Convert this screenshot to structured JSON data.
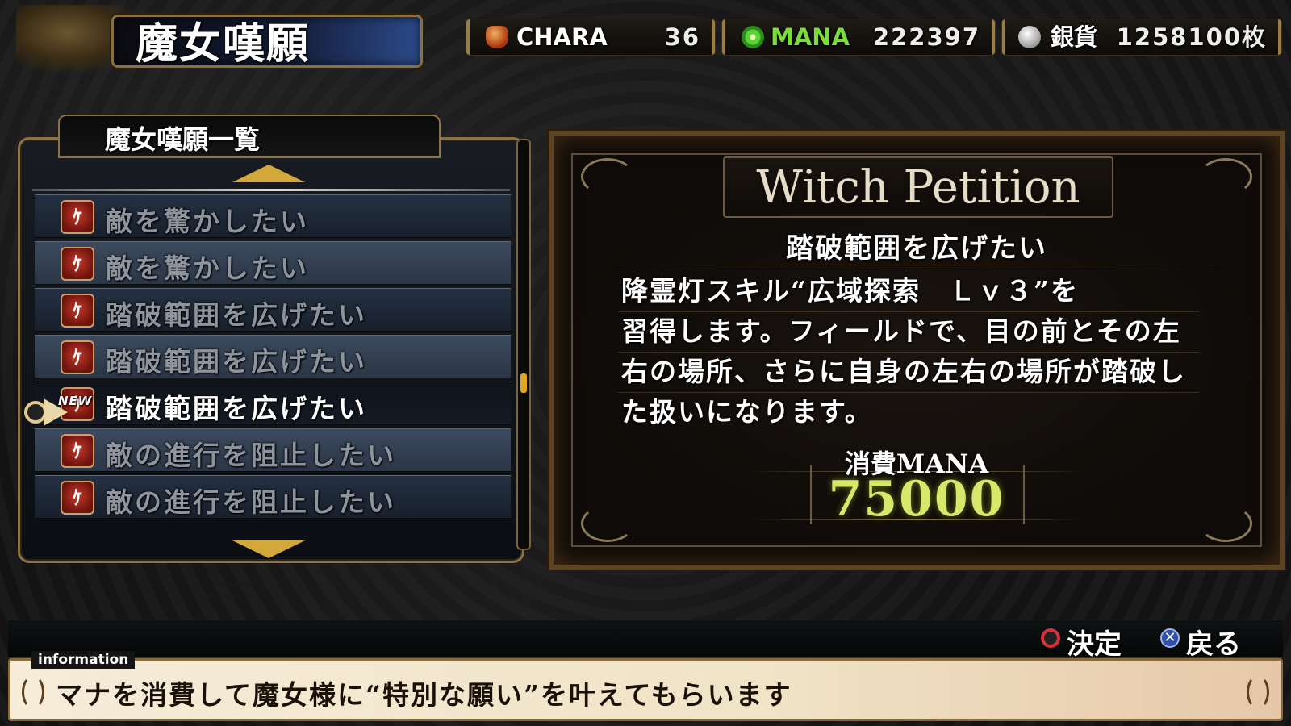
{
  "header": {
    "title": "魔女嘆願"
  },
  "stats": {
    "chara": {
      "label": "CHARA",
      "value": "36",
      "icon": "character-icon"
    },
    "mana": {
      "label": "MANA",
      "value": "222397",
      "icon": "mana-orb-icon"
    },
    "silver": {
      "label": "銀貨",
      "value": "1258100枚",
      "icon": "silver-coin-icon"
    }
  },
  "list": {
    "title": "魔女嘆願一覧",
    "badge_glyph": "ｹ",
    "new_tag": "NEW",
    "items": [
      {
        "label": "敵を驚かしたい",
        "selected": false,
        "is_new": false
      },
      {
        "label": "敵を驚かしたい",
        "selected": false,
        "is_new": false
      },
      {
        "label": "踏破範囲を広げたい",
        "selected": false,
        "is_new": false
      },
      {
        "label": "踏破範囲を広げたい",
        "selected": false,
        "is_new": false
      },
      {
        "label": "踏破範囲を広げたい",
        "selected": true,
        "is_new": true
      },
      {
        "label": "敵の進行を阻止したい",
        "selected": false,
        "is_new": false
      },
      {
        "label": "敵の進行を阻止したい",
        "selected": false,
        "is_new": false
      }
    ],
    "scroll_position": 0.6
  },
  "detail": {
    "panel_title": "Witch Petition",
    "heading": "踏破範囲を広げたい",
    "description_lines": [
      "降霊灯スキル“広域探索　Ｌｖ３”を",
      "習得します。フィールドで、目の前とその左",
      "右の場所、さらに自身の左右の場所が踏破し",
      "た扱いになります。"
    ],
    "cost_label": "消費MANA",
    "cost_value": "75000"
  },
  "controls": {
    "confirm_label": "決定",
    "back_label": "戻る",
    "back_glyph": "✕"
  },
  "info": {
    "tab": "information",
    "text": "マナを消費して魔女様に“特別な願い”を叶えてもらいます"
  },
  "colors": {
    "accent_gold": "#d4a73a",
    "mana_green": "#7cdc3c",
    "cost_yellow": "#d8e66a",
    "confirm_red": "#d8303a",
    "back_blue": "#2f50a8"
  }
}
